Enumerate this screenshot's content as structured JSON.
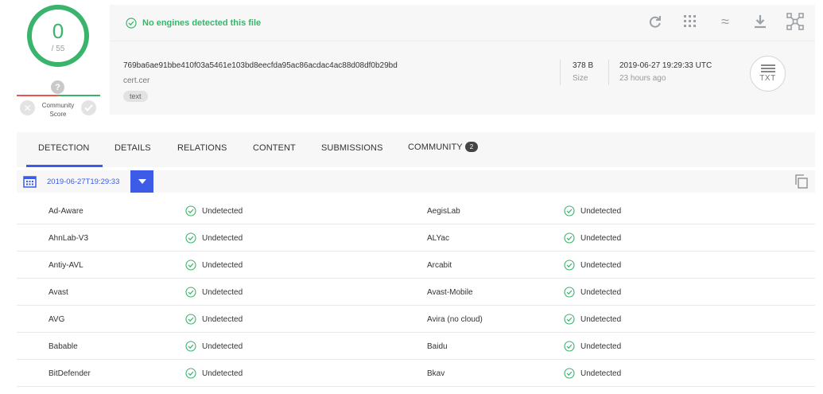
{
  "score": {
    "detections": "0",
    "total": "/ 55"
  },
  "community": {
    "label": "Community Score",
    "question": "?"
  },
  "status_message": "No engines detected this file",
  "toolbar": {
    "icons": [
      "refresh-icon",
      "similar-icon",
      "approx-icon",
      "download-icon",
      "graph-icon"
    ]
  },
  "file": {
    "hash": "769ba6ae91bbe410f03a5461e103bd8eecfda95ac86acdac4ac88d08df0b29bd",
    "name": "cert.cer",
    "tag": "text",
    "size_value": "378 B",
    "size_label": "Size",
    "date_value": "2019-06-27 19:29:33 UTC",
    "date_label": "23 hours ago",
    "type_icon": "TXT"
  },
  "tabs": [
    {
      "label": "DETECTION"
    },
    {
      "label": "DETAILS"
    },
    {
      "label": "RELATIONS"
    },
    {
      "label": "CONTENT"
    },
    {
      "label": "SUBMISSIONS"
    },
    {
      "label": "COMMUNITY",
      "badge": "2"
    }
  ],
  "analysis_date": "2019-06-27T19:29:33",
  "results": [
    {
      "left": {
        "engine": "Ad-Aware",
        "result": "Undetected"
      },
      "right": {
        "engine": "AegisLab",
        "result": "Undetected"
      }
    },
    {
      "left": {
        "engine": "AhnLab-V3",
        "result": "Undetected"
      },
      "right": {
        "engine": "ALYac",
        "result": "Undetected"
      }
    },
    {
      "left": {
        "engine": "Antiy-AVL",
        "result": "Undetected"
      },
      "right": {
        "engine": "Arcabit",
        "result": "Undetected"
      }
    },
    {
      "left": {
        "engine": "Avast",
        "result": "Undetected"
      },
      "right": {
        "engine": "Avast-Mobile",
        "result": "Undetected"
      }
    },
    {
      "left": {
        "engine": "AVG",
        "result": "Undetected"
      },
      "right": {
        "engine": "Avira (no cloud)",
        "result": "Undetected"
      }
    },
    {
      "left": {
        "engine": "Babable",
        "result": "Undetected"
      },
      "right": {
        "engine": "Baidu",
        "result": "Undetected"
      }
    },
    {
      "left": {
        "engine": "BitDefender",
        "result": "Undetected"
      },
      "right": {
        "engine": "Bkav",
        "result": "Undetected"
      }
    }
  ],
  "colors": {
    "clean": "#3ab46c",
    "accent": "#3c5be7",
    "malicious": "#e8554e"
  }
}
